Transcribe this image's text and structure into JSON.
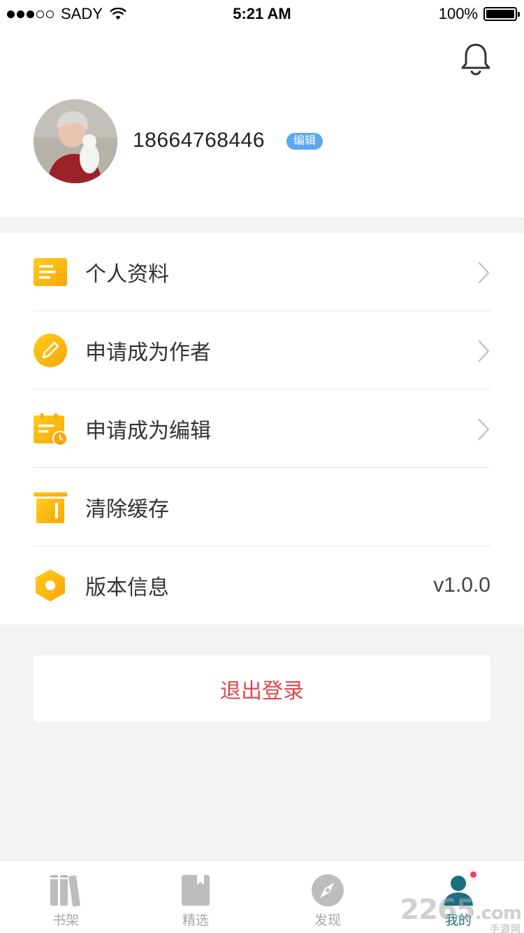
{
  "status_bar": {
    "carrier": "SADY",
    "time": "5:21 AM",
    "battery": "100%"
  },
  "profile": {
    "phone": "18664768446",
    "edit_label": "编辑"
  },
  "menu": {
    "items": [
      {
        "label": "个人资料",
        "icon": "profile-doc-icon"
      },
      {
        "label": "申请成为作者",
        "icon": "pencil-circle-icon"
      },
      {
        "label": "申请成为编辑",
        "icon": "clipboard-clock-icon"
      },
      {
        "label": "清除缓存",
        "icon": "trash-icon"
      },
      {
        "label": "版本信息",
        "icon": "hexagon-icon",
        "value": "v1.0.0"
      }
    ]
  },
  "logout_label": "退出登录",
  "tabbar": {
    "tabs": [
      {
        "label": "书架",
        "icon": "bookshelf-icon"
      },
      {
        "label": "精选",
        "icon": "bookmark-book-icon"
      },
      {
        "label": "发现",
        "icon": "compass-icon"
      },
      {
        "label": "我的",
        "icon": "user-icon"
      }
    ]
  },
  "colors": {
    "accent": "#1b6f80",
    "icon_yellow": "#f9b50b",
    "logout_red": "#e0474f",
    "badge_blue": "#5aa6f0"
  },
  "watermark": {
    "main": "2265",
    "sub": "手游网",
    "suffix": ".com"
  }
}
